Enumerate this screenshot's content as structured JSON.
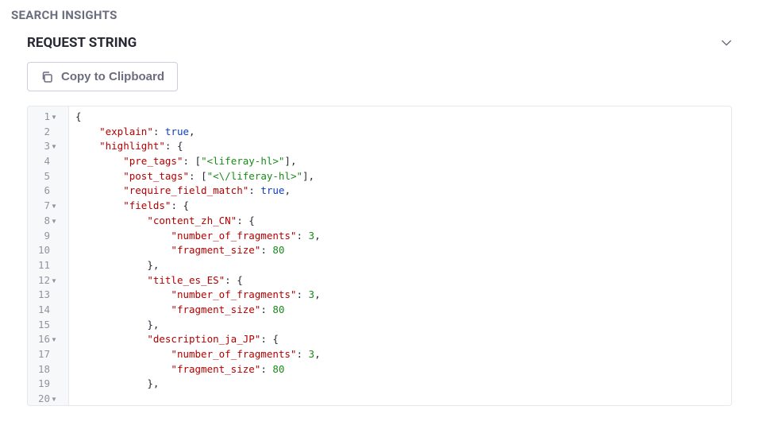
{
  "pageTitle": "SEARCH INSIGHTS",
  "section": {
    "title": "REQUEST STRING",
    "collapsed": false,
    "copyLabel": "Copy to Clipboard"
  },
  "editor": {
    "lineCount": 20,
    "foldLines": [
      1,
      3,
      7,
      8,
      12,
      16,
      20
    ],
    "lines": [
      {
        "tokens": [
          {
            "t": "punct",
            "v": "{"
          }
        ]
      },
      {
        "tokens": [
          {
            "t": "indent",
            "v": "    "
          },
          {
            "t": "key",
            "v": "\"explain\""
          },
          {
            "t": "punct",
            "v": ": "
          },
          {
            "t": "bool",
            "v": "true"
          },
          {
            "t": "punct",
            "v": ","
          }
        ]
      },
      {
        "tokens": [
          {
            "t": "indent",
            "v": "    "
          },
          {
            "t": "key",
            "v": "\"highlight\""
          },
          {
            "t": "punct",
            "v": ": {"
          }
        ]
      },
      {
        "tokens": [
          {
            "t": "indent",
            "v": "        "
          },
          {
            "t": "key",
            "v": "\"pre_tags\""
          },
          {
            "t": "punct",
            "v": ": ["
          },
          {
            "t": "str",
            "v": "\"<liferay-hl>\""
          },
          {
            "t": "punct",
            "v": "],"
          }
        ]
      },
      {
        "tokens": [
          {
            "t": "indent",
            "v": "        "
          },
          {
            "t": "key",
            "v": "\"post_tags\""
          },
          {
            "t": "punct",
            "v": ": ["
          },
          {
            "t": "str",
            "v": "\"<\\/liferay-hl>\""
          },
          {
            "t": "punct",
            "v": "],"
          }
        ]
      },
      {
        "tokens": [
          {
            "t": "indent",
            "v": "        "
          },
          {
            "t": "key",
            "v": "\"require_field_match\""
          },
          {
            "t": "punct",
            "v": ": "
          },
          {
            "t": "bool",
            "v": "true"
          },
          {
            "t": "punct",
            "v": ","
          }
        ]
      },
      {
        "tokens": [
          {
            "t": "indent",
            "v": "        "
          },
          {
            "t": "key",
            "v": "\"fields\""
          },
          {
            "t": "punct",
            "v": ": {"
          }
        ]
      },
      {
        "tokens": [
          {
            "t": "indent",
            "v": "            "
          },
          {
            "t": "key",
            "v": "\"content_zh_CN\""
          },
          {
            "t": "punct",
            "v": ": {"
          }
        ]
      },
      {
        "tokens": [
          {
            "t": "indent",
            "v": "                "
          },
          {
            "t": "key",
            "v": "\"number_of_fragments\""
          },
          {
            "t": "punct",
            "v": ": "
          },
          {
            "t": "num",
            "v": "3"
          },
          {
            "t": "punct",
            "v": ","
          }
        ]
      },
      {
        "tokens": [
          {
            "t": "indent",
            "v": "                "
          },
          {
            "t": "key",
            "v": "\"fragment_size\""
          },
          {
            "t": "punct",
            "v": ": "
          },
          {
            "t": "num",
            "v": "80"
          }
        ]
      },
      {
        "tokens": [
          {
            "t": "indent",
            "v": "            "
          },
          {
            "t": "punct",
            "v": "},"
          }
        ]
      },
      {
        "tokens": [
          {
            "t": "indent",
            "v": "            "
          },
          {
            "t": "key",
            "v": "\"title_es_ES\""
          },
          {
            "t": "punct",
            "v": ": {"
          }
        ]
      },
      {
        "tokens": [
          {
            "t": "indent",
            "v": "                "
          },
          {
            "t": "key",
            "v": "\"number_of_fragments\""
          },
          {
            "t": "punct",
            "v": ": "
          },
          {
            "t": "num",
            "v": "3"
          },
          {
            "t": "punct",
            "v": ","
          }
        ]
      },
      {
        "tokens": [
          {
            "t": "indent",
            "v": "                "
          },
          {
            "t": "key",
            "v": "\"fragment_size\""
          },
          {
            "t": "punct",
            "v": ": "
          },
          {
            "t": "num",
            "v": "80"
          }
        ]
      },
      {
        "tokens": [
          {
            "t": "indent",
            "v": "            "
          },
          {
            "t": "punct",
            "v": "},"
          }
        ]
      },
      {
        "tokens": [
          {
            "t": "indent",
            "v": "            "
          },
          {
            "t": "key",
            "v": "\"description_ja_JP\""
          },
          {
            "t": "punct",
            "v": ": {"
          }
        ]
      },
      {
        "tokens": [
          {
            "t": "indent",
            "v": "                "
          },
          {
            "t": "key",
            "v": "\"number_of_fragments\""
          },
          {
            "t": "punct",
            "v": ": "
          },
          {
            "t": "num",
            "v": "3"
          },
          {
            "t": "punct",
            "v": ","
          }
        ]
      },
      {
        "tokens": [
          {
            "t": "indent",
            "v": "                "
          },
          {
            "t": "key",
            "v": "\"fragment_size\""
          },
          {
            "t": "punct",
            "v": ": "
          },
          {
            "t": "num",
            "v": "80"
          }
        ]
      },
      {
        "tokens": [
          {
            "t": "indent",
            "v": "            "
          },
          {
            "t": "punct",
            "v": "},"
          }
        ]
      },
      {
        "tokens": []
      }
    ]
  }
}
